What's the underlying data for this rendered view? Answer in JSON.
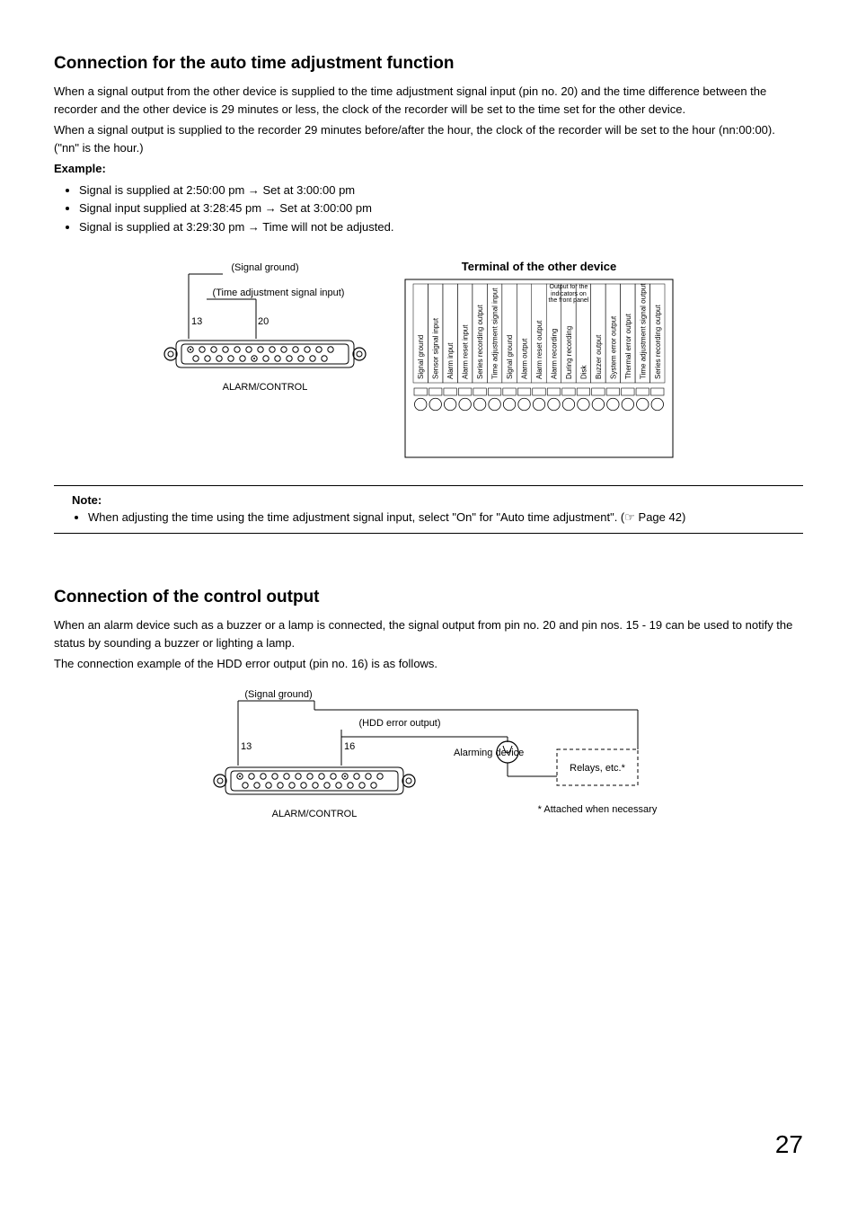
{
  "section1": {
    "heading": "Connection for the auto time adjustment function",
    "para1": "When a signal output from the other device is supplied to the time adjustment signal input (pin no. 20) and the time difference between the recorder and the other device is 29 minutes or less, the clock of the recorder will be set to the time set for the other device.",
    "para2": "When a signal output is supplied to the recorder 29 minutes before/after the hour, the clock of the recorder will be set to the hour (nn:00:00). (\"nn\" is the hour.)",
    "example_label": "Example:",
    "bullets": [
      "Signal is supplied at 2:50:00 pm → Set at 3:00:00 pm",
      "Signal input supplied at 3:28:45 pm → Set at 3:00:00 pm",
      "Signal is supplied at 3:29:30 pm → Time will not be adjusted."
    ],
    "diagram": {
      "signal_ground": "(Signal ground)",
      "time_adj": "(Time adjustment signal input)",
      "pin13": "13",
      "pin20": "20",
      "alarm_control": "ALARM/CONTROL"
    },
    "terminal": {
      "title": "Terminal of the other device",
      "front_panel": "Output for the indicators on the front panel",
      "labels": [
        "Signal ground",
        "Sensor signal input",
        "Alarm input",
        "Alarm reset input",
        "Series recording output",
        "Time adjustment signal input",
        "Signal ground",
        "Alarm output",
        "Alarm reset output",
        "Alarm recording",
        "During recording",
        "Disk",
        "Buzzer output",
        "System error output",
        "Thermal error output",
        "Time adjustment signal output",
        "Series recording output"
      ]
    }
  },
  "note": {
    "title": "Note:",
    "bullet": "When adjusting the time using the time adjustment signal input, select \"On\" for \"Auto time adjustment\". (☞ Page 42)"
  },
  "section2": {
    "heading": "Connection of the control output",
    "para1": "When an alarm device such as a buzzer or a lamp is connected, the signal output from pin no. 20 and pin nos. 15 - 19 can be used to notify the status by sounding a buzzer or lighting a lamp.",
    "para2": "The connection example of the HDD error output (pin no. 16) is as follows.",
    "diagram": {
      "signal_ground": "(Signal ground)",
      "hdd_error": "(HDD error output)",
      "pin13": "13",
      "pin16": "16",
      "alarm_control": "ALARM/CONTROL",
      "alarming_device": "Alarming device",
      "relays": "Relays, etc.*",
      "attached": "* Attached when necessary"
    }
  },
  "page_number": "27"
}
